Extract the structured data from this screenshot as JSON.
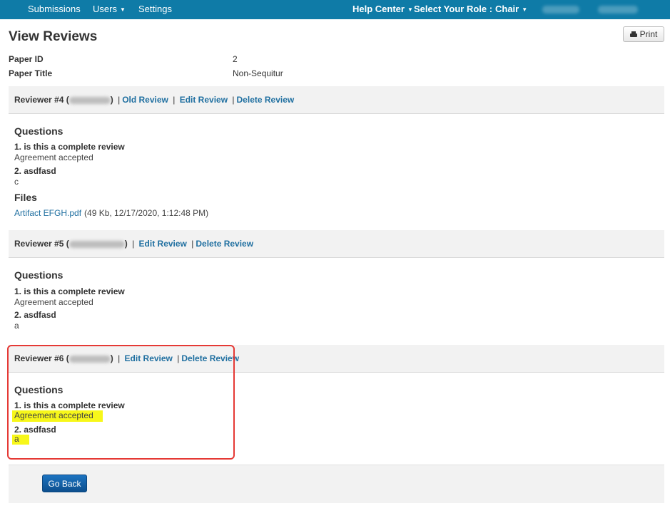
{
  "nav": {
    "submissions": "Submissions",
    "users": "Users",
    "settings": "Settings",
    "help_center": "Help Center",
    "select_role": "Select Your Role :",
    "role": "Chair"
  },
  "page": {
    "title": "View Reviews",
    "print": "Print"
  },
  "paper": {
    "id_label": "Paper ID",
    "id_value": "2",
    "title_label": "Paper Title",
    "title_value": "Non-Sequitur"
  },
  "reviews": [
    {
      "name": "Reviewer #4 (",
      "links": [
        "Old Review",
        "Edit Review",
        "Delete Review"
      ],
      "questions_heading": "Questions",
      "questions": [
        {
          "q": "1. is this a complete review",
          "a": "Agreement accepted"
        },
        {
          "q": "2. asdfasd",
          "a": "c"
        }
      ],
      "files_heading": "Files",
      "file_name": "Artifact EFGH.pdf",
      "file_meta": "(49 Kb, 12/17/2020, 1:12:48 PM)"
    },
    {
      "name": "Reviewer #5 (",
      "links": [
        "Edit Review",
        "Delete Review"
      ],
      "questions_heading": "Questions",
      "questions": [
        {
          "q": "1. is this a complete review",
          "a": "Agreement accepted"
        },
        {
          "q": "2. asdfasd",
          "a": "a"
        }
      ]
    },
    {
      "name": "Reviewer #6 (",
      "links": [
        "Edit Review",
        "Delete Review"
      ],
      "questions_heading": "Questions",
      "questions": [
        {
          "q": "1. is this a complete review",
          "a": "Agreement accepted"
        },
        {
          "q": "2. asdfasd",
          "a": "a"
        }
      ]
    }
  ],
  "footer": {
    "go_back": "Go Back"
  },
  "colors": {
    "topbar": "#0f7ba7",
    "link": "#1f6fa0",
    "highlight": "#f7f71a",
    "annotation_box": "#e53935",
    "button": "#1565b0"
  },
  "icons": {
    "print": "printer-icon",
    "dropdown": "caret-down-icon"
  }
}
